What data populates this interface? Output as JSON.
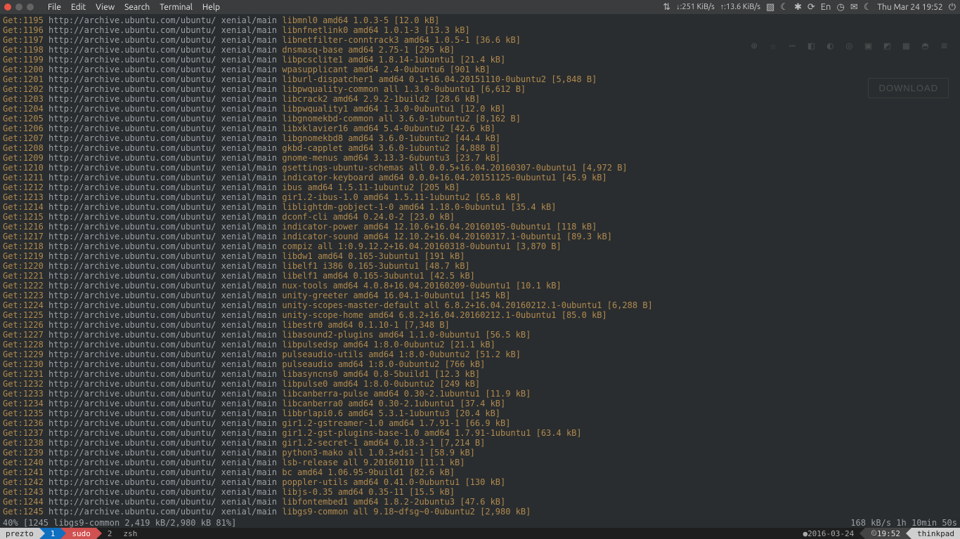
{
  "menubar": {
    "items": [
      "File",
      "Edit",
      "View",
      "Search",
      "Terminal",
      "Help"
    ],
    "net_down": "↓:251 KiB/s",
    "net_up": "↑:13.6 KiB/s",
    "lang": "En",
    "clock": "Thu Mar 24 19:52"
  },
  "download_btn": "DOWNLOAD",
  "apt_prefix": "http://archive.ubuntu.com/ubuntu/ xenial/main ",
  "apt_lines": [
    {
      "n": 1195,
      "rest": "libmnl0 amd64 1.0.3-5 [12.0 kB]"
    },
    {
      "n": 1196,
      "rest": "libnfnetlink0 amd64 1.0.1-3 [13.3 kB]"
    },
    {
      "n": 1197,
      "rest": "libnetfilter-conntrack3 amd64 1.0.5-1 [36.6 kB]"
    },
    {
      "n": 1198,
      "rest": "dnsmasq-base amd64 2.75-1 [295 kB]"
    },
    {
      "n": 1199,
      "rest": "libpcsclite1 amd64 1.8.14-1ubuntu1 [21.4 kB]"
    },
    {
      "n": 1200,
      "rest": "wpasupplicant amd64 2.4-0ubuntu6 [901 kB]"
    },
    {
      "n": 1201,
      "rest": "liburl-dispatcher1 amd64 0.1+16.04.20151110-0ubuntu2 [5,848 B]"
    },
    {
      "n": 1202,
      "rest": "libpwquality-common all 1.3.0-0ubuntu1 [6,612 B]"
    },
    {
      "n": 1203,
      "rest": "libcrack2 amd64 2.9.2-1build2 [28.6 kB]"
    },
    {
      "n": 1204,
      "rest": "libpwquality1 amd64 1.3.0-0ubuntu1 [12.0 kB]"
    },
    {
      "n": 1205,
      "rest": "libgnomekbd-common all 3.6.0-1ubuntu2 [8,162 B]"
    },
    {
      "n": 1206,
      "rest": "libxklavier16 amd64 5.4-0ubuntu2 [42.6 kB]"
    },
    {
      "n": 1207,
      "rest": "libgnomekbd8 amd64 3.6.0-1ubuntu2 [44.4 kB]"
    },
    {
      "n": 1208,
      "rest": "gkbd-capplet amd64 3.6.0-1ubuntu2 [4,888 B]"
    },
    {
      "n": 1209,
      "rest": "gnome-menus amd64 3.13.3-6ubuntu3 [23.7 kB]"
    },
    {
      "n": 1210,
      "rest": "gsettings-ubuntu-schemas all 0.0.5+16.04.20160307-0ubuntu1 [4,972 B]"
    },
    {
      "n": 1211,
      "rest": "indicator-keyboard amd64 0.0.0+16.04.20151125-0ubuntu1 [45.9 kB]"
    },
    {
      "n": 1212,
      "rest": "ibus amd64 1.5.11-1ubuntu2 [205 kB]"
    },
    {
      "n": 1213,
      "rest": "gir1.2-ibus-1.0 amd64 1.5.11-1ubuntu2 [65.8 kB]"
    },
    {
      "n": 1214,
      "rest": "liblightdm-gobject-1-0 amd64 1.18.0-0ubuntu1 [35.4 kB]"
    },
    {
      "n": 1215,
      "rest": "dconf-cli amd64 0.24.0-2 [23.0 kB]"
    },
    {
      "n": 1216,
      "rest": "indicator-power amd64 12.10.6+16.04.20160105-0ubuntu1 [118 kB]"
    },
    {
      "n": 1217,
      "rest": "indicator-sound amd64 12.10.2+16.04.20160317.1-0ubuntu1 [89.3 kB]"
    },
    {
      "n": 1218,
      "rest": "compiz all 1:0.9.12.2+16.04.20160318-0ubuntu1 [3,870 B]"
    },
    {
      "n": 1219,
      "rest": "libdw1 amd64 0.165-3ubuntu1 [191 kB]"
    },
    {
      "n": 1220,
      "rest": "libelf1 i386 0.165-3ubuntu1 [48.7 kB]"
    },
    {
      "n": 1221,
      "rest": "libelf1 amd64 0.165-3ubuntu1 [42.5 kB]"
    },
    {
      "n": 1222,
      "rest": "nux-tools amd64 4.0.8+16.04.20160209-0ubuntu1 [10.1 kB]"
    },
    {
      "n": 1223,
      "rest": "unity-greeter amd64 16.04.1-0ubuntu1 [145 kB]"
    },
    {
      "n": 1224,
      "rest": "unity-scopes-master-default all 6.8.2+16.04.20160212.1-0ubuntu1 [6,288 B]"
    },
    {
      "n": 1225,
      "rest": "unity-scope-home amd64 6.8.2+16.04.20160212.1-0ubuntu1 [85.0 kB]"
    },
    {
      "n": 1226,
      "rest": "libestr0 amd64 0.1.10-1 [7,348 B]"
    },
    {
      "n": 1227,
      "rest": "libasound2-plugins amd64 1.1.0-0ubuntu1 [56.5 kB]"
    },
    {
      "n": 1228,
      "rest": "libpulsedsp amd64 1:8.0-0ubuntu2 [21.1 kB]"
    },
    {
      "n": 1229,
      "rest": "pulseaudio-utils amd64 1:8.0-0ubuntu2 [51.2 kB]"
    },
    {
      "n": 1230,
      "rest": "pulseaudio amd64 1:8.0-0ubuntu2 [766 kB]"
    },
    {
      "n": 1231,
      "rest": "libasyncns0 amd64 0.8-5build1 [12.3 kB]"
    },
    {
      "n": 1232,
      "rest": "libpulse0 amd64 1:8.0-0ubuntu2 [249 kB]"
    },
    {
      "n": 1233,
      "rest": "libcanberra-pulse amd64 0.30-2.1ubuntu1 [11.9 kB]"
    },
    {
      "n": 1234,
      "rest": "libcanberra0 amd64 0.30-2.1ubuntu1 [37.4 kB]"
    },
    {
      "n": 1235,
      "rest": "libbrlapi0.6 amd64 5.3.1-1ubuntu3 [20.4 kB]"
    },
    {
      "n": 1236,
      "rest": "gir1.2-gstreamer-1.0 amd64 1.7.91-1 [66.9 kB]"
    },
    {
      "n": 1237,
      "rest": "gir1.2-gst-plugins-base-1.0 amd64 1.7.91-1ubuntu1 [63.4 kB]"
    },
    {
      "n": 1238,
      "rest": "gir1.2-secret-1 amd64 0.18.3-1 [7,214 B]"
    },
    {
      "n": 1239,
      "rest": "python3-mako all 1.0.3+ds1-1 [58.9 kB]"
    },
    {
      "n": 1240,
      "rest": "lsb-release all 9.20160110 [11.1 kB]"
    },
    {
      "n": 1241,
      "rest": "bc amd64 1.06.95-9build1 [82.6 kB]"
    },
    {
      "n": 1242,
      "rest": "poppler-utils amd64 0.41.0-0ubuntu1 [130 kB]"
    },
    {
      "n": 1243,
      "rest": "libjs-0.35 amd64 0.35-11 [15.5 kB]"
    },
    {
      "n": 1244,
      "rest": "libfontembed1 amd64 1.8.2-2ubuntu3 [47.6 kB]"
    },
    {
      "n": 1245,
      "rest": "libgs9-common all 9.18~dfsg~0-0ubuntu2 [2,980 kB]"
    }
  ],
  "progress": {
    "left": "40% [1245 libgs9-common 2,419 kB/2,980 kB 81%]",
    "right": "168 kB/s 1h 10min 50s"
  },
  "statusbar": {
    "prezto": "prezto",
    "n1": "1",
    "sudo": "sudo",
    "n2": "2",
    "zsh": "zsh",
    "date": "2016-03-24",
    "time": "19:52",
    "host": "thinkpad"
  }
}
